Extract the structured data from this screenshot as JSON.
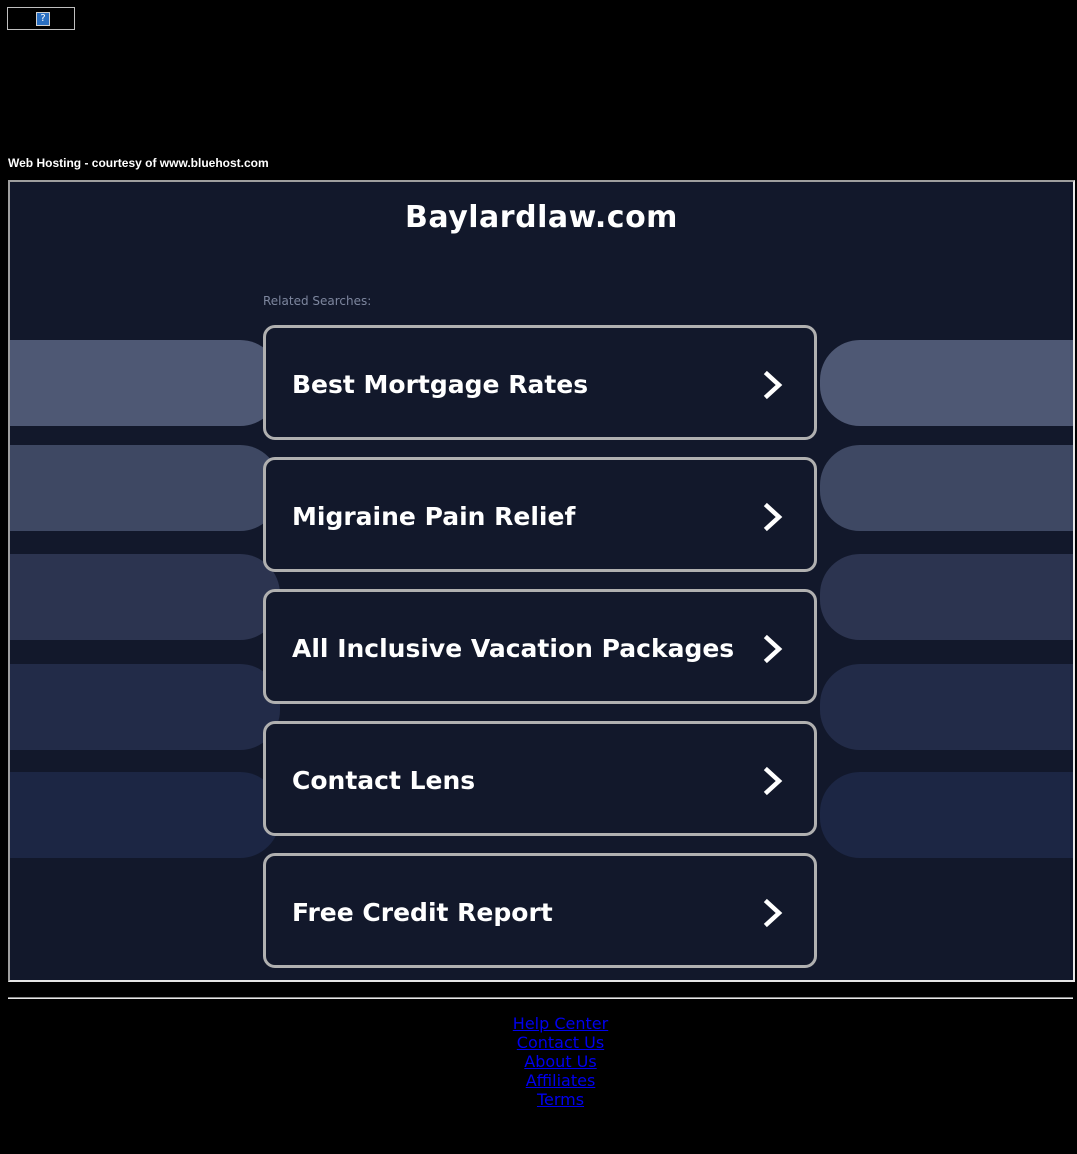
{
  "top_ad": {
    "icon": "broken-image-icon",
    "glyph": "?"
  },
  "hosting_text": "Web Hosting - courtesy of www.bluehost.com",
  "site": {
    "title": "Baylardlaw.com",
    "related_label": "Related Searches:"
  },
  "links": [
    {
      "label": "Best Mortgage Rates"
    },
    {
      "label": "Migraine Pain Relief"
    },
    {
      "label": "All Inclusive Vacation Packages"
    },
    {
      "label": "Contact Lens"
    },
    {
      "label": "Free Credit Report"
    }
  ],
  "footer": {
    "links": [
      "Help Center",
      "Contact Us",
      "About Us",
      "Affiliates",
      "Terms"
    ]
  },
  "colors": {
    "page_bg": "#000000",
    "panel_bg": "#12182b",
    "box_border": "#b0b0b0",
    "side_bar_shades": [
      "#4e5874",
      "#3e4863",
      "#2c3450",
      "#222b48",
      "#1c2644"
    ],
    "footer_link": "#0000ee"
  }
}
